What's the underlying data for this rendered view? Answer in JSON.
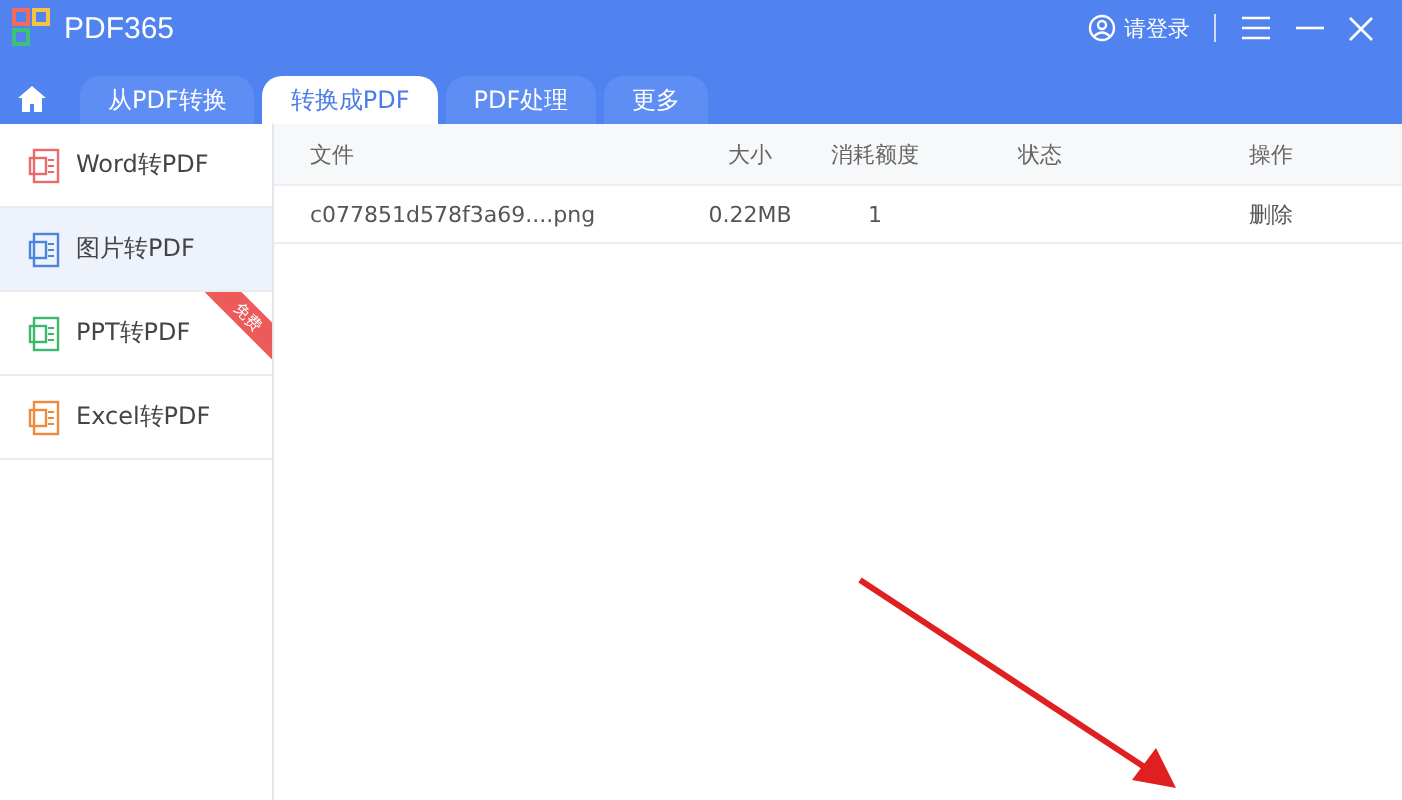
{
  "app": {
    "title": "PDF365",
    "login": "请登录"
  },
  "tabs": [
    {
      "label": "从PDF转换",
      "selected": false
    },
    {
      "label": "转换成PDF",
      "selected": true
    },
    {
      "label": "PDF处理",
      "selected": false
    },
    {
      "label": "更多",
      "selected": false
    }
  ],
  "sidebar": {
    "items": [
      {
        "label": "Word转PDF",
        "selected": false,
        "color": "#e86a6a"
      },
      {
        "label": "图片转PDF",
        "selected": true,
        "color": "#4a86e0"
      },
      {
        "label": "PPT转PDF",
        "selected": false,
        "color": "#3bb86a",
        "badge": "免费"
      },
      {
        "label": "Excel转PDF",
        "selected": false,
        "color": "#ef8a3c"
      }
    ]
  },
  "table": {
    "columns": [
      "文件",
      "大小",
      "消耗额度",
      "状态",
      "操作"
    ],
    "rows": [
      [
        "c077851d578f3a69....png",
        "0.22MB",
        "1",
        "",
        "删除"
      ]
    ]
  }
}
